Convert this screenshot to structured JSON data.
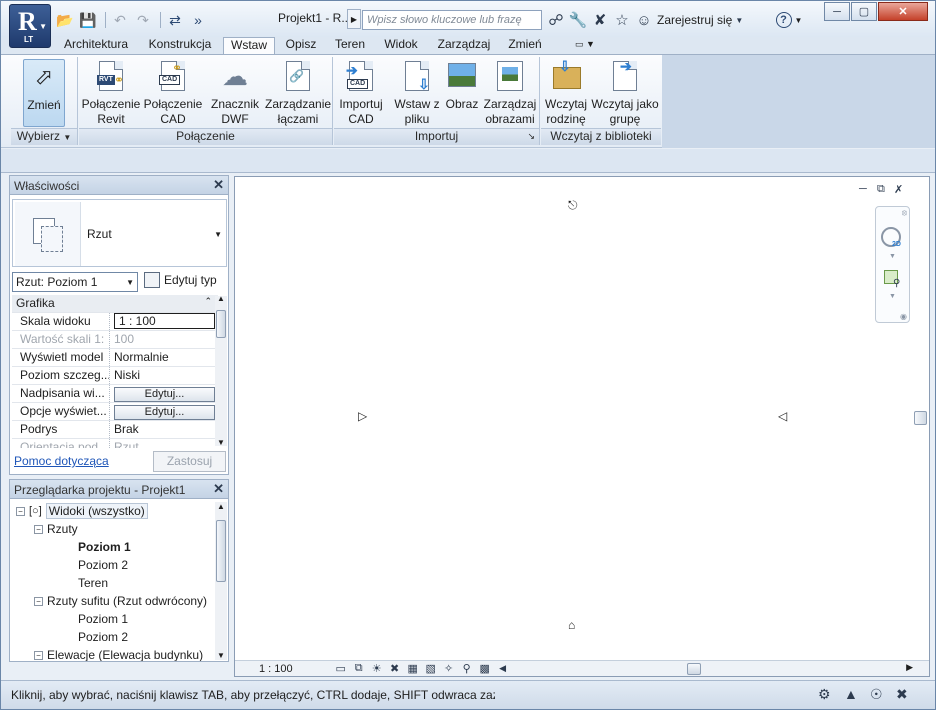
{
  "app": {
    "logo_letter": "R",
    "logo_sub": "LT"
  },
  "title": {
    "text": "Projekt1 - R...",
    "search_placeholder": "Wpisz słowo kluczowe lub frazę",
    "signin": "Zarejestruj się",
    "help": "?"
  },
  "quick_access": [
    "open-icon",
    "save-icon",
    "undo-icon",
    "redo-icon",
    "measure-icon",
    "more-icon"
  ],
  "tabs": [
    {
      "label": "Architektura"
    },
    {
      "label": "Konstrukcja"
    },
    {
      "label": "Wstaw",
      "active": true
    },
    {
      "label": "Opisz"
    },
    {
      "label": "Teren"
    },
    {
      "label": "Widok"
    },
    {
      "label": "Zarządzaj"
    },
    {
      "label": "Zmień"
    }
  ],
  "ribbon": {
    "modify": "Zmień",
    "select_panel": "Wybierz",
    "link_revit": "Połączenie Revit",
    "link_cad": "Połączenie CAD",
    "dwf_markup": "Znacznik DWF",
    "manage_links": "Zarządzanie łączami",
    "link_panel": "Połączenie",
    "import_cad": "Importuj CAD",
    "insert_from_file": "Wstaw z pliku",
    "image": "Obraz",
    "manage_images": "Zarządzaj obrazami",
    "import_panel": "Importuj",
    "load_family": "Wczytaj rodzinę",
    "load_as_group": "Wczytaj jako grupę",
    "library_panel": "Wczytaj z biblioteki",
    "icon_labels": {
      "rvt": "RVT",
      "cad": "CAD"
    }
  },
  "properties": {
    "title": "Właściwości",
    "type_name": "Rzut",
    "view_selector": "Rzut: Poziom 1",
    "edit_type": "Edytuj typ",
    "group": "Grafika",
    "rows": [
      {
        "key": "Skala widoku",
        "value": "1 : 100"
      },
      {
        "key": "Wartość skali  1:",
        "value": "100"
      },
      {
        "key": "Wyświetl model",
        "value": "Normalnie"
      },
      {
        "key": "Poziom szczeg...",
        "value": "Niski"
      },
      {
        "key": "Nadpisania wi...",
        "value": "Edytuj..."
      },
      {
        "key": "Opcje wyświet...",
        "value": "Edytuj..."
      },
      {
        "key": "Podrys",
        "value": "Brak"
      },
      {
        "key": "Orientacja pod...",
        "value": "Rzut"
      }
    ],
    "help_link": "Pomoc dotycząca",
    "apply": "Zastosuj"
  },
  "browser": {
    "title": "Przeglądarka projektu - Projekt1",
    "nodes": [
      {
        "label": "Widoki (wszystko)"
      },
      {
        "label": "Rzuty"
      },
      {
        "label": "Poziom 1"
      },
      {
        "label": "Poziom 2"
      },
      {
        "label": "Teren"
      },
      {
        "label": "Rzuty sufitu (Rzut odwrócony)"
      },
      {
        "label": "Poziom 1"
      },
      {
        "label": "Poziom 2"
      },
      {
        "label": "Elewacje (Elewacja budynku)"
      }
    ]
  },
  "view": {
    "scale": "1 : 100"
  },
  "status": {
    "message": "Kliknij, aby wybrać, naciśnij klawisz TAB, aby przełączyć, CTRL dodaje, SHIFT odwraca zaznaczenie."
  },
  "colors": {
    "accent": "#2d4a74",
    "link": "#1f56b8",
    "selected_tool": "#bcd8f0"
  }
}
